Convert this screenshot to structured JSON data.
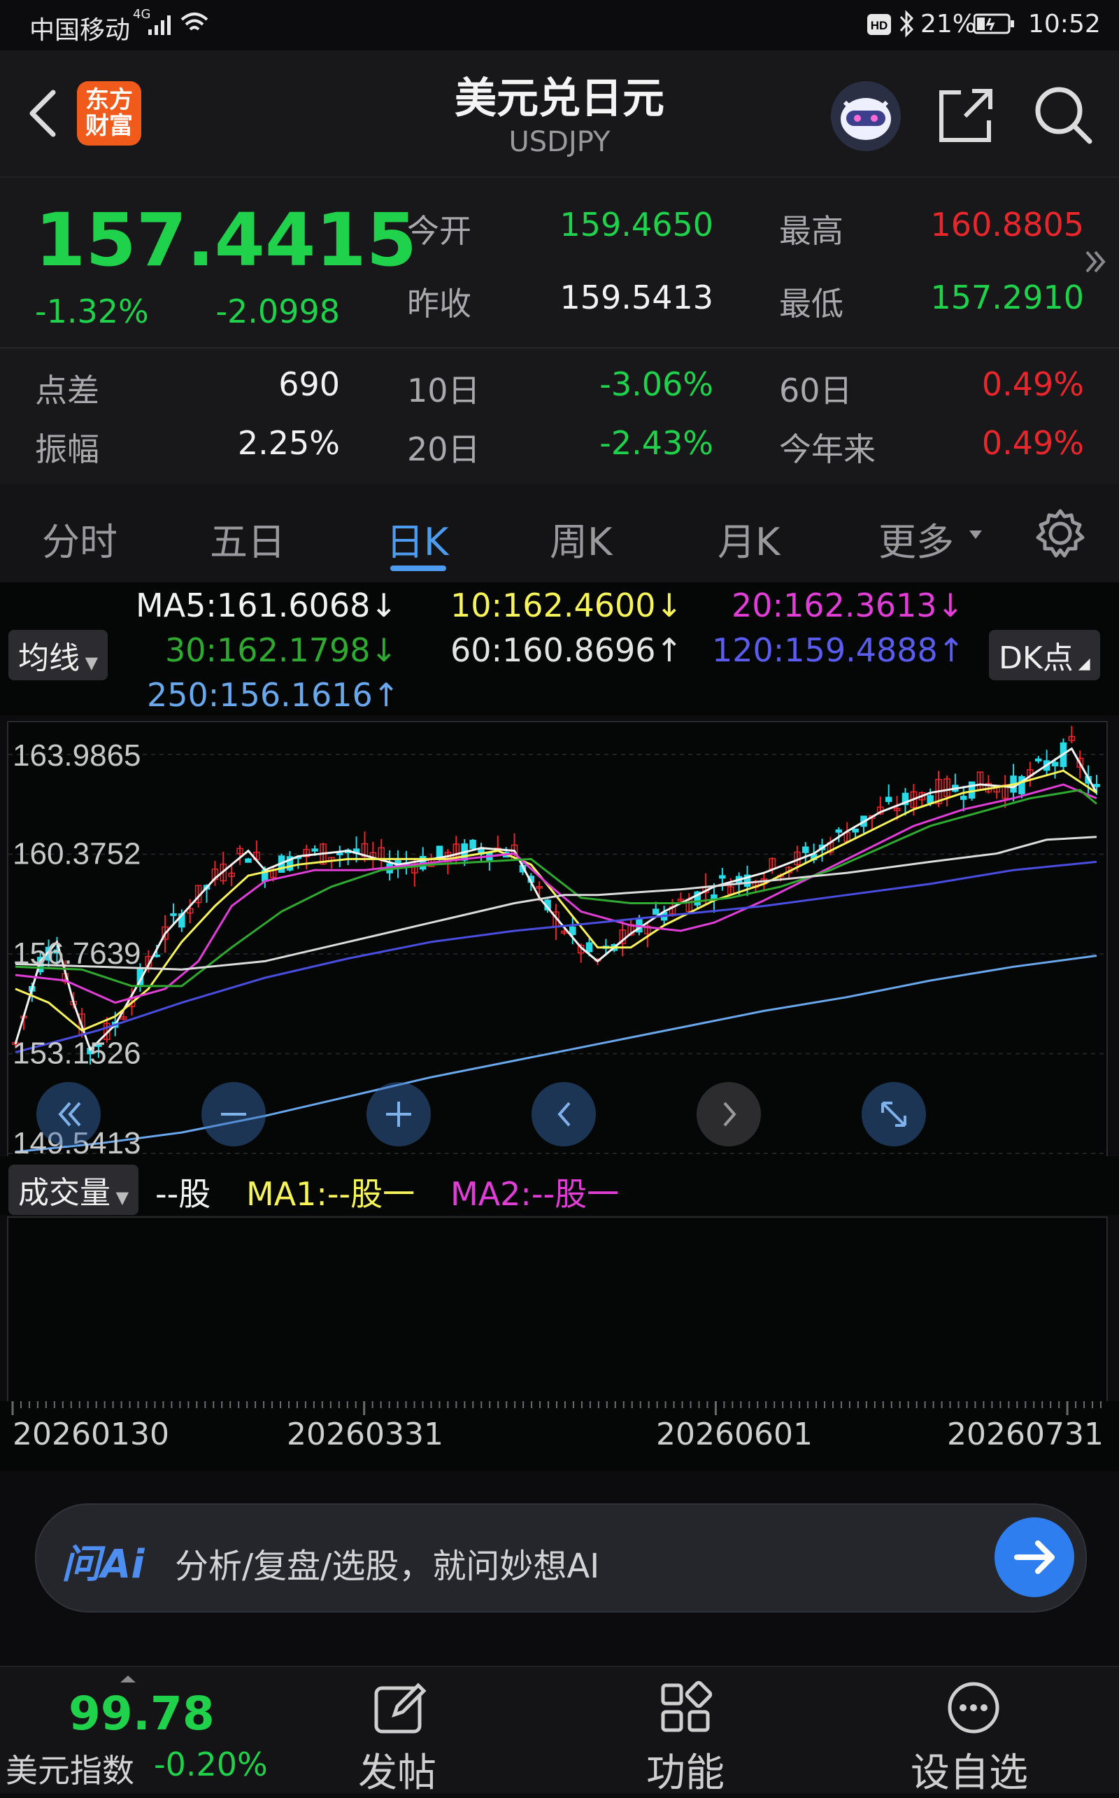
{
  "status": {
    "carrier": "中国移动",
    "network": "4G",
    "battery": "21%",
    "time": "10:52"
  },
  "header": {
    "logo_text": "东方财富",
    "title": "美元兑日元",
    "subtitle": "USDJPY"
  },
  "quote": {
    "price": "157.4415",
    "change_pct": "-1.32%",
    "change": "-2.0998",
    "open_label": "今开",
    "open": "159.4650",
    "high_label": "最高",
    "high": "160.8805",
    "prev_close_label": "昨收",
    "prev_close": "159.5413",
    "low_label": "最低",
    "low": "157.2910",
    "spread_label": "点差",
    "spread": "690",
    "amplitude_label": "振幅",
    "amplitude": "2.25%",
    "d10_label": "10日",
    "d10": "-3.06%",
    "d20_label": "20日",
    "d20": "-2.43%",
    "d60_label": "60日",
    "d60": "0.49%",
    "ytd_label": "今年来",
    "ytd": "0.49%"
  },
  "tabs": [
    "分时",
    "五日",
    "日K",
    "周K",
    "月K",
    "更多"
  ],
  "active_tab": "日K",
  "ma": {
    "selector": "均线",
    "dk_button": "DK点",
    "ma5": "MA5:161.6068↓",
    "ma10": "10:162.4600↓",
    "ma20": "20:162.3613↓",
    "ma30": "30:162.1798↓",
    "ma60": "60:160.8696↑",
    "ma120": "120:159.4888↑",
    "ma250": "250:156.1616↑"
  },
  "price_axis": [
    "163.9865",
    "160.3752",
    "156.7639",
    "153.1526",
    "149.5413"
  ],
  "volume": {
    "selector": "成交量",
    "value": "--股",
    "ma1": "MA1:--股一",
    "ma2": "MA2:--股一"
  },
  "dates": [
    "20260130",
    "20260331",
    "20260601",
    "20260731"
  ],
  "ai": {
    "logo": "问Ai",
    "placeholder": "分析/复盘/选股，就问妙想AI"
  },
  "bottom": {
    "index_value": "99.78",
    "index_name": "美元指数",
    "index_change": "-0.20%",
    "post_label": "发帖",
    "function_label": "功能",
    "watchlist_label": "设自选"
  },
  "colors": {
    "up": "#e8262c",
    "down": "#1fd14b",
    "accent": "#4d9cf0",
    "ma5": "#f2f2f2",
    "ma10": "#f7f35a",
    "ma20": "#e03ed6",
    "ma30": "#2fa930",
    "ma60": "#dcdcdc",
    "ma120": "#4a4ee0",
    "ma250": "#6aa8ee"
  },
  "chart_data": {
    "type": "line",
    "title": "",
    "xlabel": "",
    "ylabel": "",
    "ylim": [
      149.5413,
      165.0
    ],
    "x_ticks": [
      "20260130",
      "20260331",
      "20260601",
      "20260731"
    ],
    "y_ticks": [
      163.9865,
      160.3752,
      156.7639,
      153.1526,
      149.5413
    ],
    "x_index_range": [
      0,
      130
    ],
    "x_tick_index": [
      0,
      42,
      84,
      126
    ],
    "series": [
      {
        "name": "MA5",
        "values": [
          [
            0,
            153.5
          ],
          [
            3,
            156.5
          ],
          [
            5,
            157.2
          ],
          [
            7,
            155
          ],
          [
            9,
            153.3
          ],
          [
            12,
            154.2
          ],
          [
            15,
            155.8
          ],
          [
            18,
            157.5
          ],
          [
            21,
            158.5
          ],
          [
            24,
            159.5
          ],
          [
            28,
            160.5
          ],
          [
            30,
            159.8
          ],
          [
            34,
            160.3
          ],
          [
            40,
            160.5
          ],
          [
            46,
            160.0
          ],
          [
            52,
            160.3
          ],
          [
            56,
            160.6
          ],
          [
            60,
            160.5
          ],
          [
            63,
            158.8
          ],
          [
            68,
            157.0
          ],
          [
            70,
            156.5
          ],
          [
            74,
            157.5
          ],
          [
            78,
            158.3
          ],
          [
            84,
            159.2
          ],
          [
            90,
            159.7
          ],
          [
            96,
            160.4
          ],
          [
            100,
            161.2
          ],
          [
            104,
            161.9
          ],
          [
            110,
            162.6
          ],
          [
            116,
            162.9
          ],
          [
            120,
            162.8
          ],
          [
            124,
            163.6
          ],
          [
            127,
            164.2
          ],
          [
            130,
            162.6
          ]
        ]
      },
      {
        "name": "10",
        "values": [
          [
            0,
            155.5
          ],
          [
            4,
            155.0
          ],
          [
            8,
            154.0
          ],
          [
            12,
            154.5
          ],
          [
            16,
            155.5
          ],
          [
            20,
            157.2
          ],
          [
            24,
            158.5
          ],
          [
            28,
            159.6
          ],
          [
            34,
            160.0
          ],
          [
            40,
            160.2
          ],
          [
            46,
            160.2
          ],
          [
            52,
            160.2
          ],
          [
            58,
            160.5
          ],
          [
            62,
            160.0
          ],
          [
            66,
            158.5
          ],
          [
            70,
            157.0
          ],
          [
            74,
            157.0
          ],
          [
            78,
            157.8
          ],
          [
            84,
            158.7
          ],
          [
            90,
            159.3
          ],
          [
            96,
            160.2
          ],
          [
            102,
            161.1
          ],
          [
            108,
            162.0
          ],
          [
            114,
            162.6
          ],
          [
            120,
            162.9
          ],
          [
            126,
            163.4
          ],
          [
            130,
            162.6
          ]
        ]
      },
      {
        "name": "20",
        "values": [
          [
            0,
            156.0
          ],
          [
            6,
            155.8
          ],
          [
            12,
            155.0
          ],
          [
            18,
            155.5
          ],
          [
            22,
            156.5
          ],
          [
            26,
            158.5
          ],
          [
            30,
            159.4
          ],
          [
            36,
            159.8
          ],
          [
            42,
            159.8
          ],
          [
            48,
            160.0
          ],
          [
            54,
            160.2
          ],
          [
            60,
            160.4
          ],
          [
            64,
            159.3
          ],
          [
            68,
            158.3
          ],
          [
            74,
            157.8
          ],
          [
            80,
            157.6
          ],
          [
            84,
            157.9
          ],
          [
            90,
            158.7
          ],
          [
            96,
            159.6
          ],
          [
            102,
            160.5
          ],
          [
            108,
            161.4
          ],
          [
            114,
            162.0
          ],
          [
            120,
            162.4
          ],
          [
            126,
            162.9
          ],
          [
            130,
            162.4
          ]
        ]
      },
      {
        "name": "30",
        "values": [
          [
            0,
            156.3
          ],
          [
            8,
            156.2
          ],
          [
            14,
            155.6
          ],
          [
            20,
            155.6
          ],
          [
            26,
            157.0
          ],
          [
            32,
            158.3
          ],
          [
            38,
            159.2
          ],
          [
            44,
            159.8
          ],
          [
            50,
            160.0
          ],
          [
            56,
            160.1
          ],
          [
            62,
            160.2
          ],
          [
            68,
            158.8
          ],
          [
            74,
            158.6
          ],
          [
            80,
            158.6
          ],
          [
            86,
            158.8
          ],
          [
            92,
            159.2
          ],
          [
            98,
            159.8
          ],
          [
            104,
            160.6
          ],
          [
            110,
            161.4
          ],
          [
            116,
            161.9
          ],
          [
            122,
            162.4
          ],
          [
            128,
            162.7
          ],
          [
            130,
            162.2
          ]
        ]
      },
      {
        "name": "60",
        "values": [
          [
            0,
            156.4
          ],
          [
            10,
            156.3
          ],
          [
            20,
            156.2
          ],
          [
            30,
            156.5
          ],
          [
            40,
            157.2
          ],
          [
            50,
            157.9
          ],
          [
            60,
            158.6
          ],
          [
            66,
            158.9
          ],
          [
            70,
            158.9
          ],
          [
            80,
            159.1
          ],
          [
            90,
            159.4
          ],
          [
            100,
            159.7
          ],
          [
            110,
            160.1
          ],
          [
            118,
            160.4
          ],
          [
            124,
            160.9
          ],
          [
            130,
            161.0
          ]
        ]
      },
      {
        "name": "120",
        "values": [
          [
            0,
            153.2
          ],
          [
            10,
            154.0
          ],
          [
            20,
            155.0
          ],
          [
            30,
            155.9
          ],
          [
            40,
            156.6
          ],
          [
            50,
            157.2
          ],
          [
            60,
            157.6
          ],
          [
            70,
            157.9
          ],
          [
            80,
            158.2
          ],
          [
            90,
            158.5
          ],
          [
            100,
            158.9
          ],
          [
            110,
            159.3
          ],
          [
            120,
            159.8
          ],
          [
            130,
            160.1
          ]
        ]
      },
      {
        "name": "250",
        "values": [
          [
            0,
            149.6
          ],
          [
            10,
            149.9
          ],
          [
            20,
            150.3
          ],
          [
            30,
            150.9
          ],
          [
            40,
            151.6
          ],
          [
            50,
            152.3
          ],
          [
            60,
            152.9
          ],
          [
            70,
            153.5
          ],
          [
            80,
            154.1
          ],
          [
            90,
            154.7
          ],
          [
            100,
            155.2
          ],
          [
            110,
            155.8
          ],
          [
            120,
            156.3
          ],
          [
            130,
            156.7
          ]
        ]
      }
    ]
  }
}
